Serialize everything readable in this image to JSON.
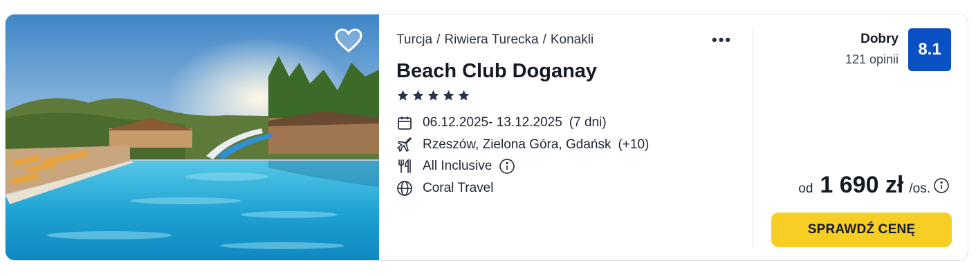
{
  "hotel": {
    "breadcrumb": [
      "Turcja",
      "Riwiera Turecka",
      "Konakli"
    ],
    "breadcrumb_separator": "/",
    "name": "Beach Club Doganay",
    "stars": 5,
    "dates": "06.12.2025- 13.12.2025",
    "duration": "(7 dni)",
    "departures": "Rzeszów, Zielona Góra, Gdańsk",
    "departures_more": "(+10)",
    "board": "All Inclusive",
    "operator": "Coral Travel",
    "more_menu": "•••"
  },
  "rating": {
    "label": "Dobry",
    "reviews": "121 opinii",
    "score": "8.1",
    "badge_color": "#0a4fc4"
  },
  "price": {
    "prefix": "od",
    "amount": "1 690 zł",
    "per": "/os."
  },
  "cta": {
    "label": "SPRAWDŹ CENĘ",
    "color": "#f7cf24"
  },
  "icons": {
    "favorite": "heart-icon",
    "dates": "calendar-icon",
    "departures": "plane-icon",
    "board": "cutlery-icon",
    "operator": "globe-icon",
    "info": "info-icon"
  }
}
